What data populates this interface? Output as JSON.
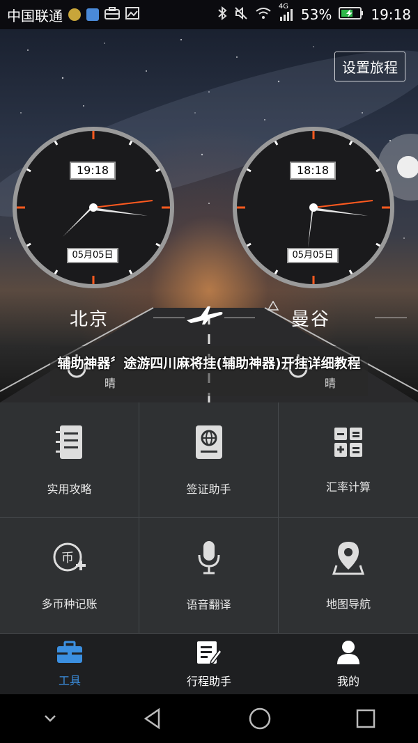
{
  "status_bar": {
    "carrier": "中国联通",
    "network": "4G",
    "battery_percent": "53%",
    "time": "19:18"
  },
  "header": {
    "settings_button": "设置旅程"
  },
  "clocks": [
    {
      "digital_time": "19:18",
      "date": "05月05日",
      "city": "北京",
      "weather": "晴"
    },
    {
      "digital_time": "18:18",
      "date": "05月05日",
      "city": "曼谷",
      "weather": "晴"
    }
  ],
  "overlay_text": "辅助神器〞途游四川麻将挂(辅助神器)开挂详细教程",
  "tools": [
    {
      "label": "实用攻略",
      "icon": "notebook-icon"
    },
    {
      "label": "签证助手",
      "icon": "passport-icon"
    },
    {
      "label": "汇率计算",
      "icon": "calculator-icon"
    },
    {
      "label": "多币种记账",
      "icon": "currency-add-icon"
    },
    {
      "label": "语音翻译",
      "icon": "microphone-icon"
    },
    {
      "label": "地图导航",
      "icon": "map-pin-icon"
    }
  ],
  "tabs": [
    {
      "label": "工具",
      "icon": "briefcase-icon",
      "active": true
    },
    {
      "label": "行程助手",
      "icon": "edit-note-icon",
      "active": false
    },
    {
      "label": "我的",
      "icon": "user-icon",
      "active": false
    }
  ],
  "colors": {
    "accent": "#3b8fe0",
    "clock_red": "#ff5a1f",
    "grid_bg": "#2f3133",
    "tab_bg": "#1e1f21"
  }
}
